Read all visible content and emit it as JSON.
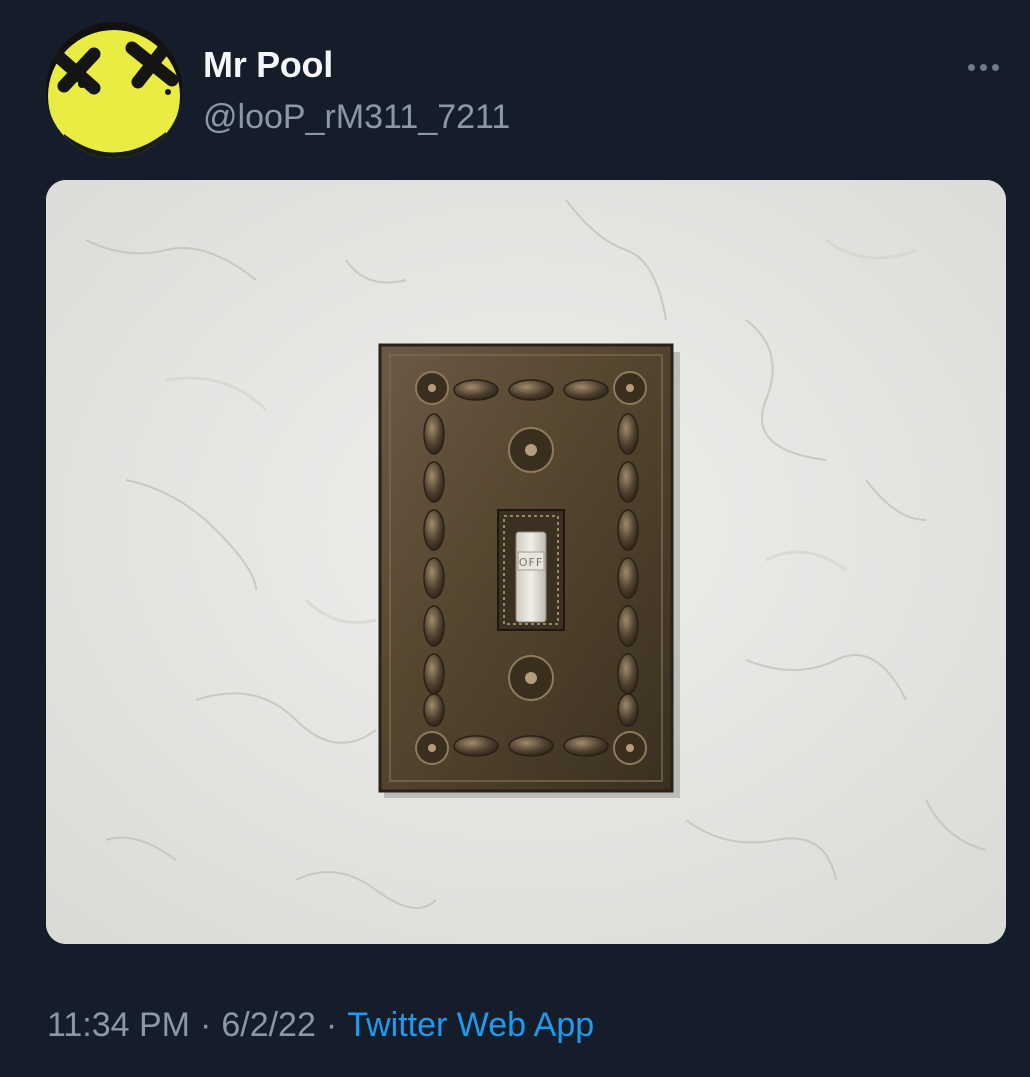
{
  "tweet": {
    "author": {
      "display_name": "Mr Pool",
      "handle": "@looP_rM311_7211",
      "avatar_icon": "dead-smiley-face-icon"
    },
    "more_icon": "more-horizontal-icon",
    "media": {
      "switch_label": "OFF"
    },
    "time": "11:34 PM",
    "date": "6/2/22",
    "separator": "·",
    "source": "Twitter Web App"
  },
  "colors": {
    "background": "#161d2a",
    "text_primary": "#f4f6f8",
    "text_secondary": "#8b98a5",
    "link": "#1d9bf0",
    "avatar_yellow": "#e9ec43"
  }
}
